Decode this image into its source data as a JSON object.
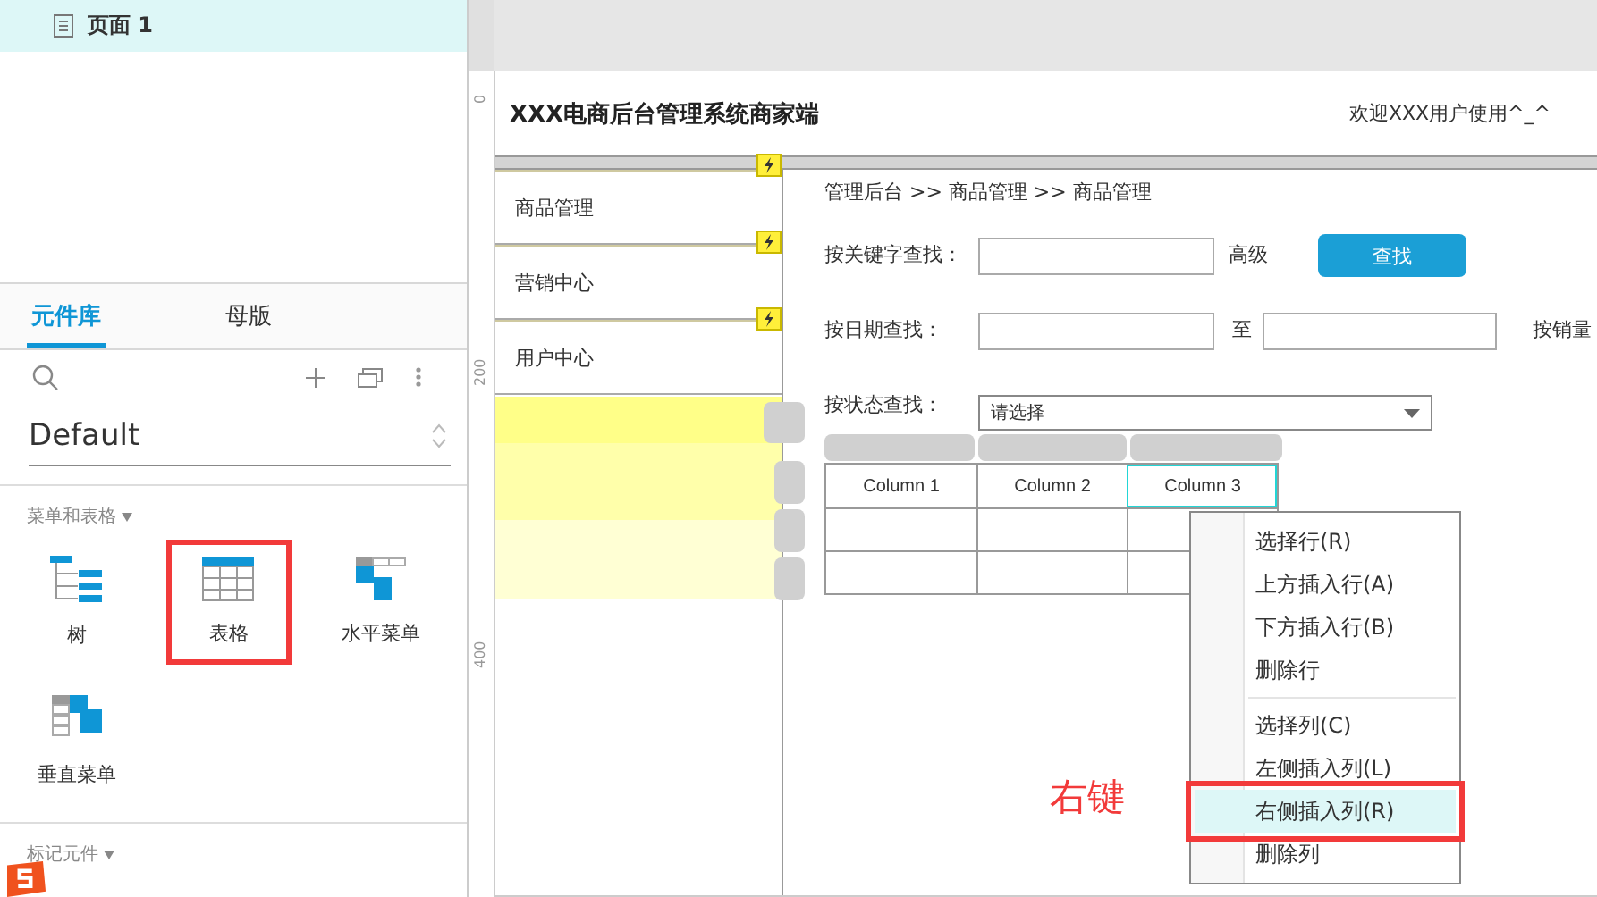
{
  "pages": [
    {
      "label": "页面 1",
      "selected": true
    }
  ],
  "library_tabs": [
    {
      "label": "元件库",
      "selected": true
    },
    {
      "label": "母版",
      "selected": false
    }
  ],
  "library_select": {
    "value": "Default"
  },
  "sections": [
    {
      "title": "菜单和表格",
      "items": [
        {
          "label": "树",
          "kind": "tree",
          "marked": false
        },
        {
          "label": "表格",
          "kind": "table",
          "marked": true
        },
        {
          "label": "水平菜单",
          "kind": "hmenu",
          "marked": false
        },
        {
          "label": "垂直菜单",
          "kind": "vmenu",
          "marked": false
        }
      ]
    },
    {
      "title": "标记元件"
    }
  ],
  "ruler": {
    "marks": [
      "0",
      "200",
      "400"
    ]
  },
  "canvas": {
    "title": "XXX电商后台管理系统商家端",
    "welcome": "欢迎XXX用户使用^_^",
    "nav": [
      "商品管理",
      "营销中心",
      "用户中心"
    ],
    "breadcrumb": "管理后台 >> 商品管理 >> 商品管理",
    "search": {
      "keyword_label": "按关键字查找：",
      "advanced": "高级",
      "button": "查找",
      "date_label": "按日期查找：",
      "to": "至",
      "sales_label": "按销量",
      "status_label": "按状态查找：",
      "status_placeholder": "请选择"
    },
    "table": {
      "columns": [
        {
          "label": "Column 1",
          "selected": false
        },
        {
          "label": "Column 2",
          "selected": false
        },
        {
          "label": "Column 3",
          "selected": true
        }
      ]
    }
  },
  "context_menu": {
    "groups": [
      [
        {
          "label": "选择行(R)",
          "hovered": false,
          "marked": false
        },
        {
          "label": "上方插入行(A)",
          "hovered": false,
          "marked": false
        },
        {
          "label": "下方插入行(B)",
          "hovered": false,
          "marked": false
        },
        {
          "label": "删除行",
          "hovered": false,
          "marked": false
        }
      ],
      [
        {
          "label": "选择列(C)",
          "hovered": false,
          "marked": false
        },
        {
          "label": "左侧插入列(L)",
          "hovered": false,
          "marked": false
        },
        {
          "label": "右侧插入列(R)",
          "hovered": true,
          "marked": true
        },
        {
          "label": "删除列",
          "hovered": false,
          "marked": false
        }
      ]
    ]
  },
  "annotation": "右键"
}
